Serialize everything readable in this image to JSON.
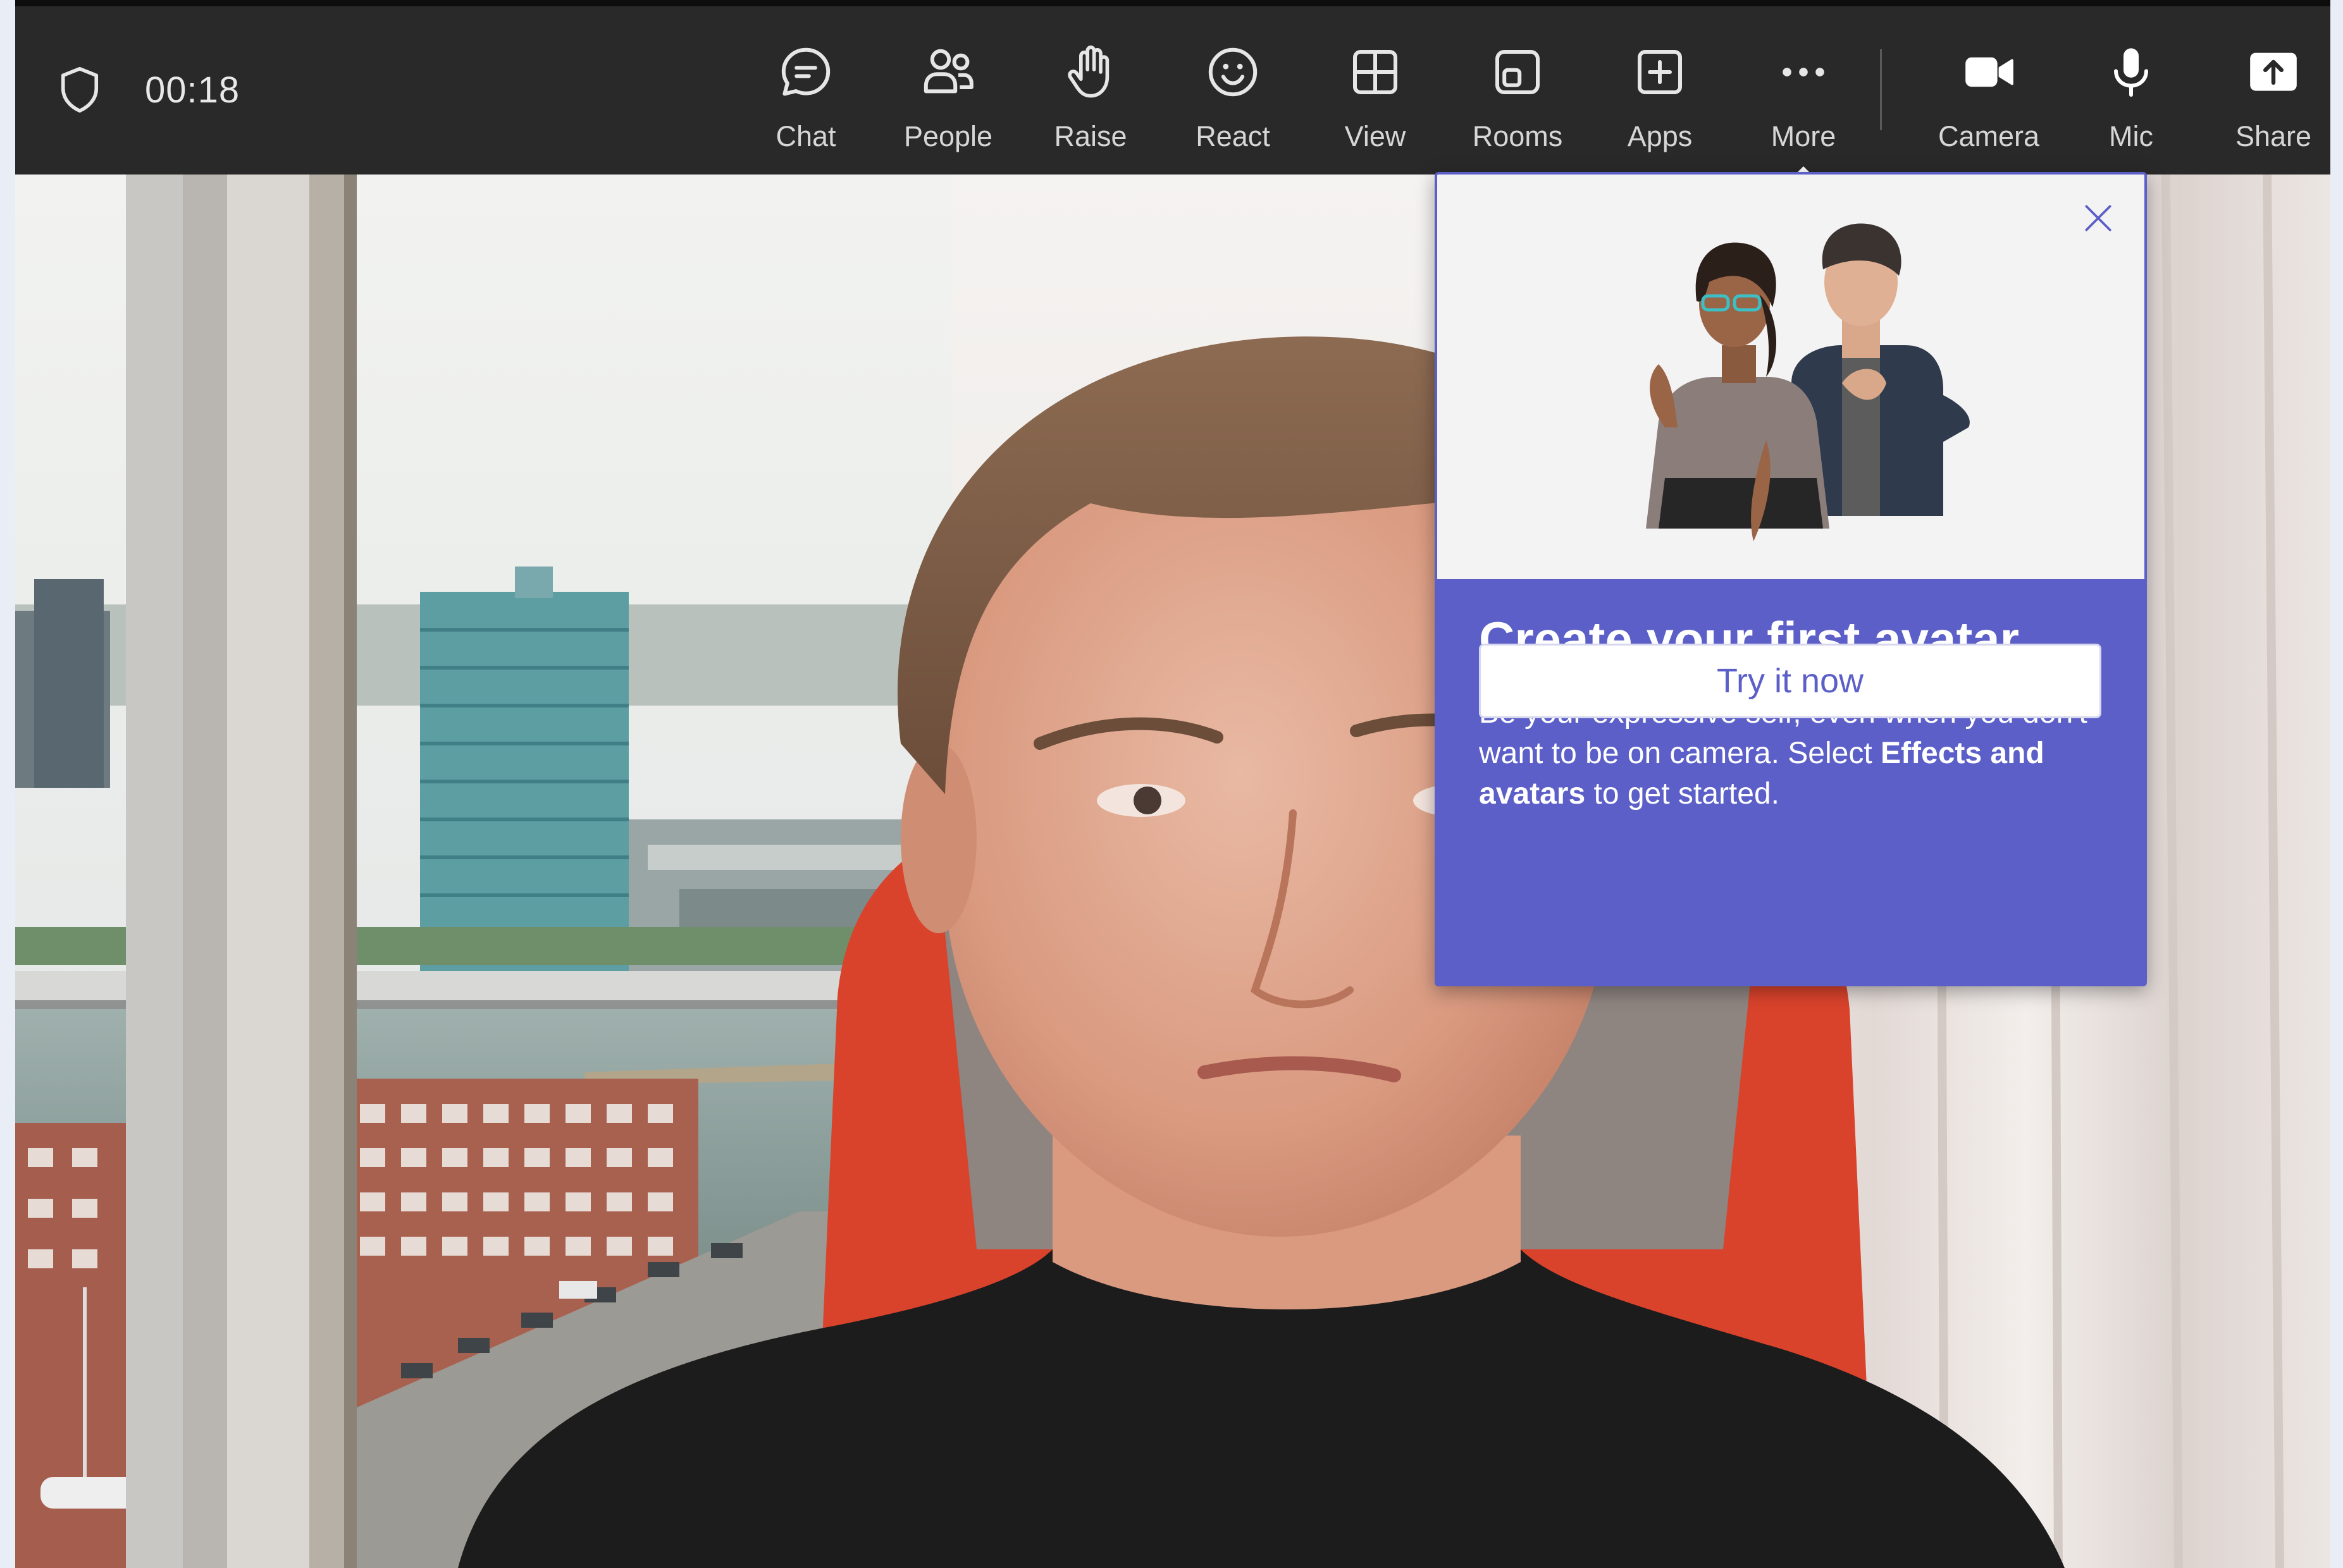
{
  "meeting": {
    "timer": "00:18"
  },
  "toolbar": {
    "items": [
      {
        "label": "Chat",
        "icon": "chat-icon"
      },
      {
        "label": "People",
        "icon": "people-icon"
      },
      {
        "label": "Raise",
        "icon": "raise-hand-icon"
      },
      {
        "label": "React",
        "icon": "react-smiley-icon"
      },
      {
        "label": "View",
        "icon": "view-grid-icon"
      },
      {
        "label": "Rooms",
        "icon": "rooms-icon"
      },
      {
        "label": "Apps",
        "icon": "apps-plus-icon"
      },
      {
        "label": "More",
        "icon": "more-ellipsis-icon"
      },
      {
        "label": "Camera",
        "icon": "camera-icon"
      },
      {
        "label": "Mic",
        "icon": "mic-icon"
      },
      {
        "label": "Share",
        "icon": "share-tray-icon"
      }
    ]
  },
  "popover": {
    "title": "Create your first avatar",
    "body_part1": "Be your expressive self, even when you don't want to be on camera. Select ",
    "body_bold": "Effects and avatars",
    "body_part2": " to get started.",
    "cta_label": "Try it now"
  },
  "colors": {
    "toolbar_bg": "#292929",
    "accent": "#5b5fc7",
    "icon_light": "#e6e6e6",
    "icon_white": "#ffffff"
  }
}
